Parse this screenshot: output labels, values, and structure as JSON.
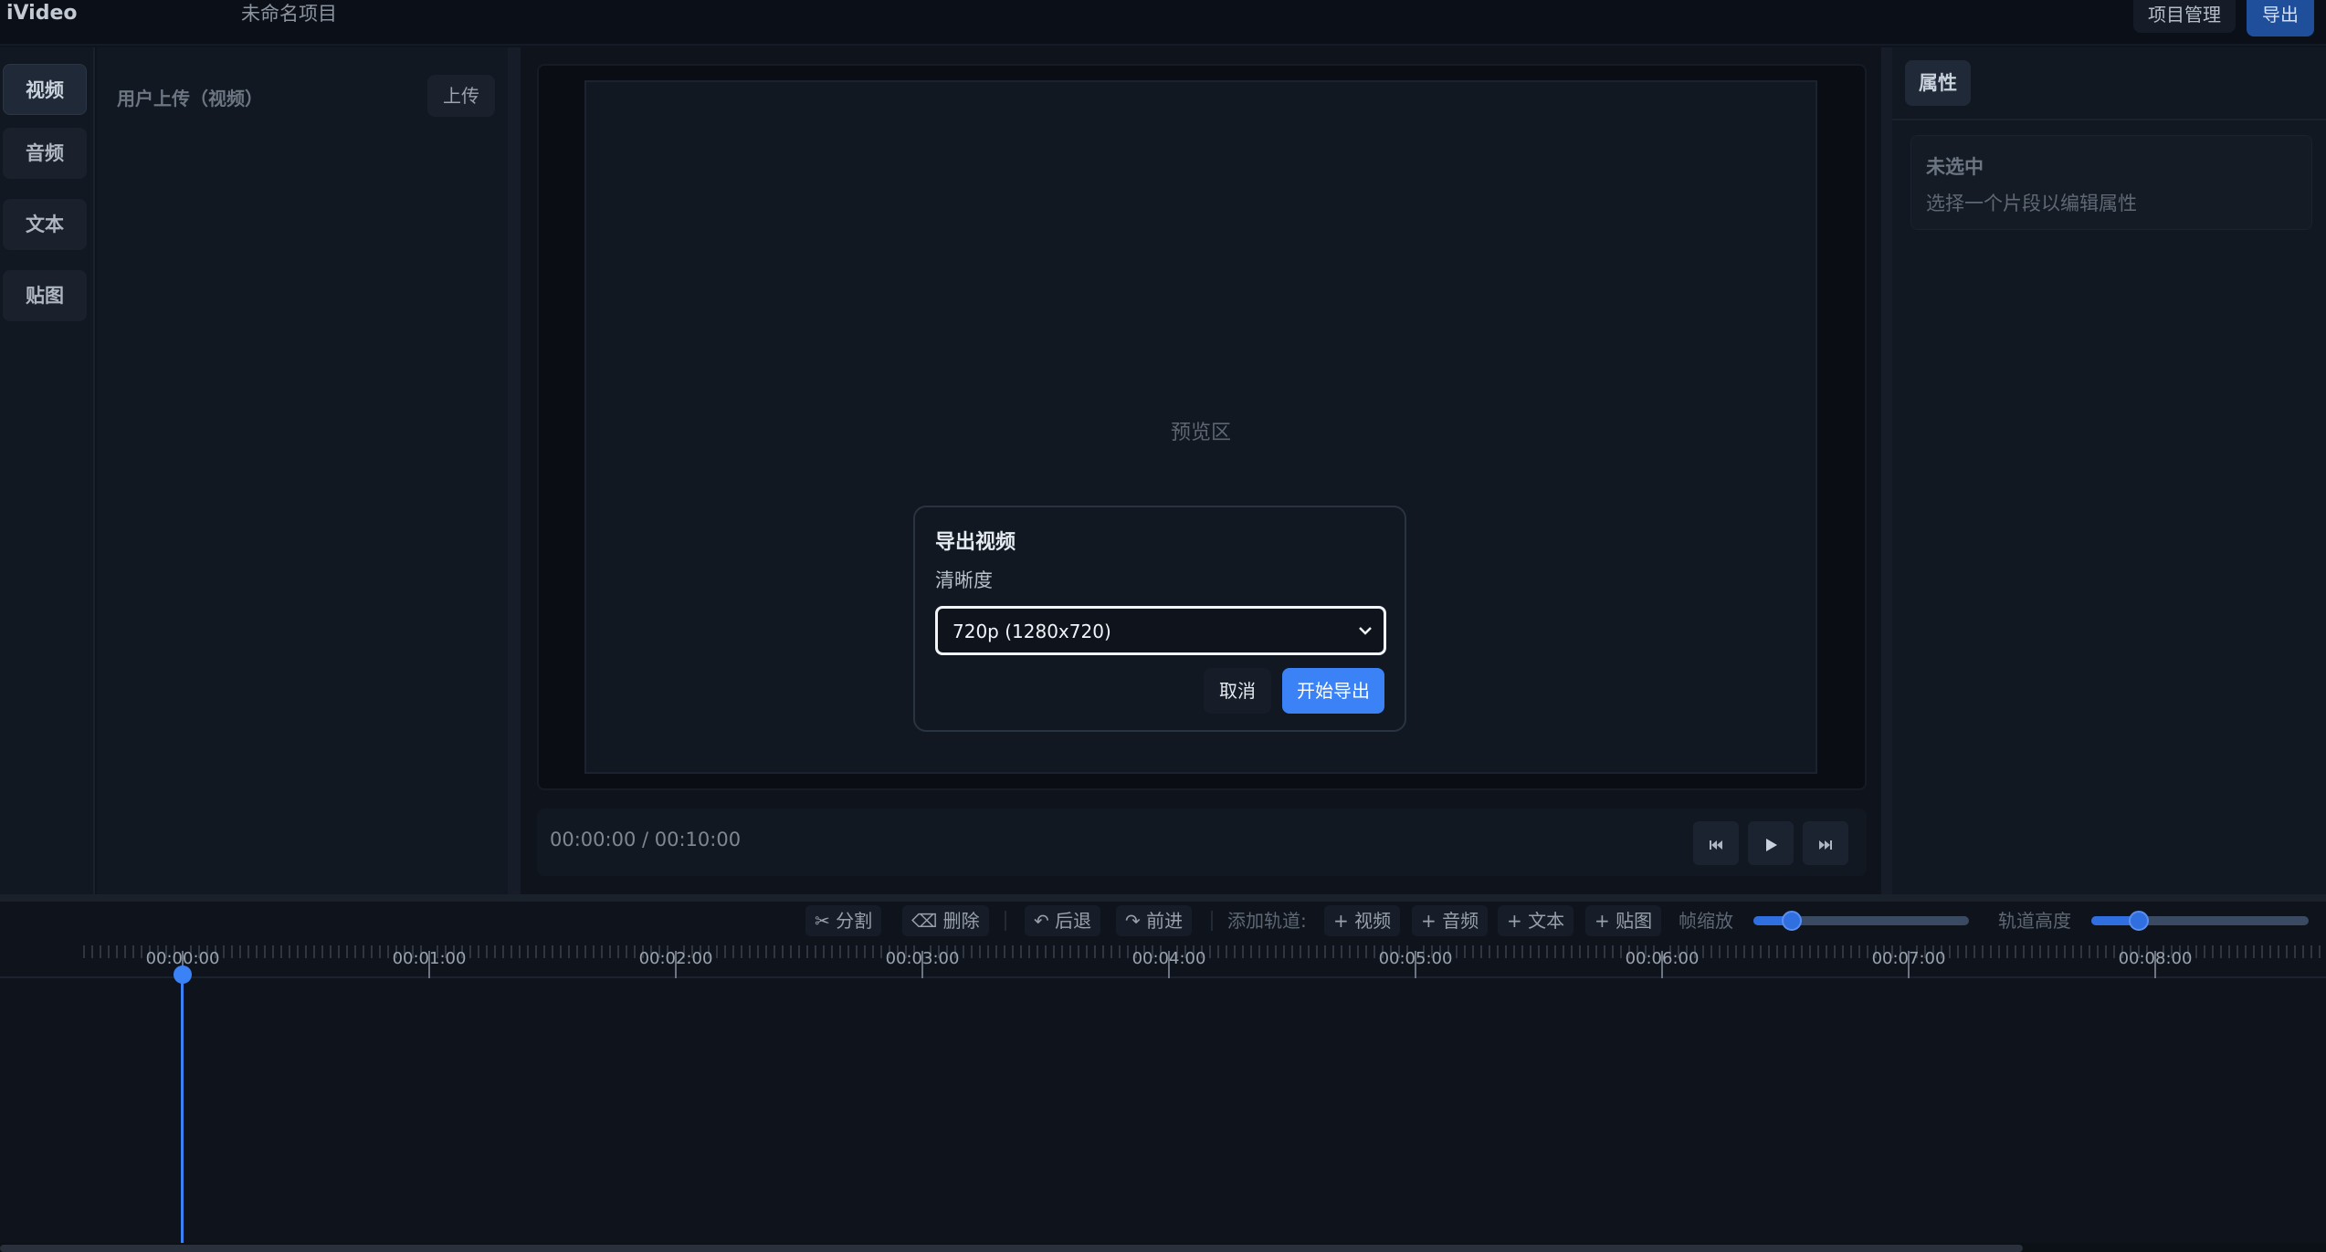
{
  "app": {
    "logo": "iVideo",
    "project_title": "未命名项目"
  },
  "header": {
    "project_manage_label": "项目管理",
    "export_label": "导出"
  },
  "leftnav": {
    "items": [
      {
        "label": "视频",
        "active": true
      },
      {
        "label": "音频",
        "active": false
      },
      {
        "label": "文本",
        "active": false
      },
      {
        "label": "贴图",
        "active": false
      }
    ]
  },
  "media": {
    "title": "用户上传（视频）",
    "upload_label": "上传"
  },
  "preview": {
    "placeholder": "预览区",
    "timecode": "00:00:00 / 00:10:00"
  },
  "properties": {
    "tab_label": "属性",
    "empty_title": "未选中",
    "empty_hint": "选择一个片段以编辑属性"
  },
  "timeline": {
    "toolbar": {
      "split_label": "✂ 分割",
      "delete_label": "⌫ 删除",
      "undo_label": "↶ 后退",
      "redo_label": "↷ 前进",
      "add_track_label": "添加轨道:",
      "add_video_label": "+ 视频",
      "add_audio_label": "+ 音频",
      "add_text_label": "+ 文本",
      "add_sticker_label": "+ 贴图",
      "zoom_label": "帧缩放",
      "zoom_level": 0.18,
      "track_height_label": "轨道高度",
      "track_height_level": 0.22
    },
    "ruler_labels": [
      "00:00:00",
      "00:01:00",
      "00:02:00",
      "00:03:00",
      "00:04:00",
      "00:05:00",
      "00:06:00",
      "00:07:00",
      "00:08:00"
    ],
    "playhead_time": "00:00:00"
  },
  "modal": {
    "title": "导出视频",
    "quality_label": "清晰度",
    "quality_value": "720p (1280x720)",
    "cancel_label": "取消",
    "start_label": "开始导出"
  },
  "colors": {
    "accent": "#3b82f6",
    "background": "#0f141c",
    "panel": "#121821"
  },
  "icons": {
    "prev": "skip-back-icon",
    "play": "play-icon",
    "next": "skip-forward-icon",
    "select_chevron": "chevron-down-icon"
  }
}
